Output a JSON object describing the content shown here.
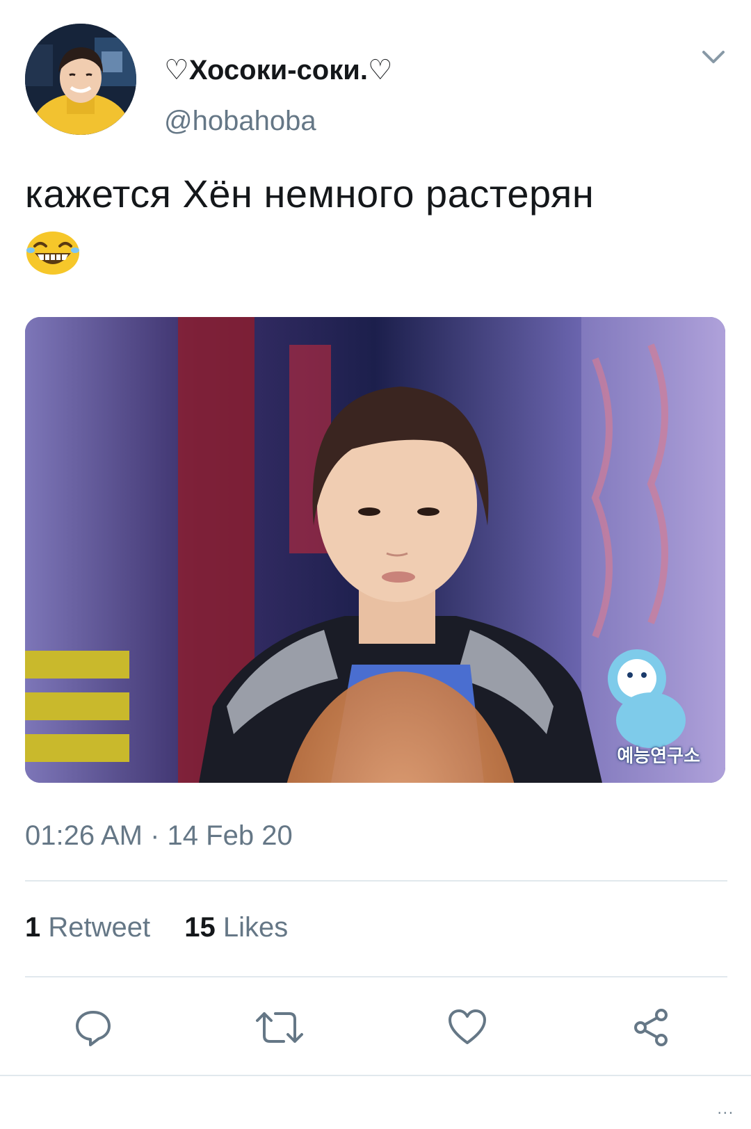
{
  "user": {
    "display_name": "♡Хосоки-соки.♡",
    "handle": "@hobahoba",
    "avatar_icon": "profile-photo"
  },
  "tweet": {
    "text": "кажется Хён немного растерян",
    "emoji": "😂",
    "timestamp": "01:26 AM · 14 Feb 20"
  },
  "media": {
    "watermark": "예능연구소"
  },
  "stats": {
    "retweets_count": "1",
    "retweets_label": "Retweet",
    "likes_count": "15",
    "likes_label": "Likes"
  },
  "actions": {
    "reply_icon": "reply-icon",
    "retweet_icon": "retweet-icon",
    "like_icon": "heart-icon",
    "share_icon": "share-icon"
  },
  "footer": {
    "more": "..."
  },
  "colors": {
    "text_primary": "#14171a",
    "text_secondary": "#657786",
    "divider": "#e1e8ed",
    "icon": "#657786"
  }
}
